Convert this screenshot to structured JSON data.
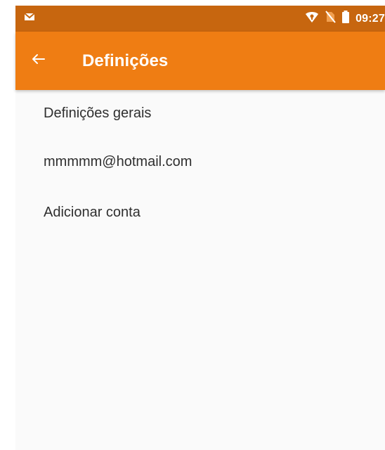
{
  "status_bar": {
    "time": "09:27",
    "icons": {
      "left": "mail-notification-icon",
      "right": [
        "wifi-icon",
        "no-sim-icon",
        "battery-icon"
      ]
    }
  },
  "app_bar": {
    "back_icon": "arrow-left-icon",
    "title": "Definições"
  },
  "settings_list": {
    "items": [
      {
        "label": "Definições gerais"
      },
      {
        "label": "mmmmm@hotmail.com"
      },
      {
        "label": "Adicionar conta"
      }
    ]
  },
  "colors": {
    "status_bar": "#c7660f",
    "app_bar": "#ef7d13",
    "background": "#fafafa",
    "text": "#2f2f2f"
  }
}
